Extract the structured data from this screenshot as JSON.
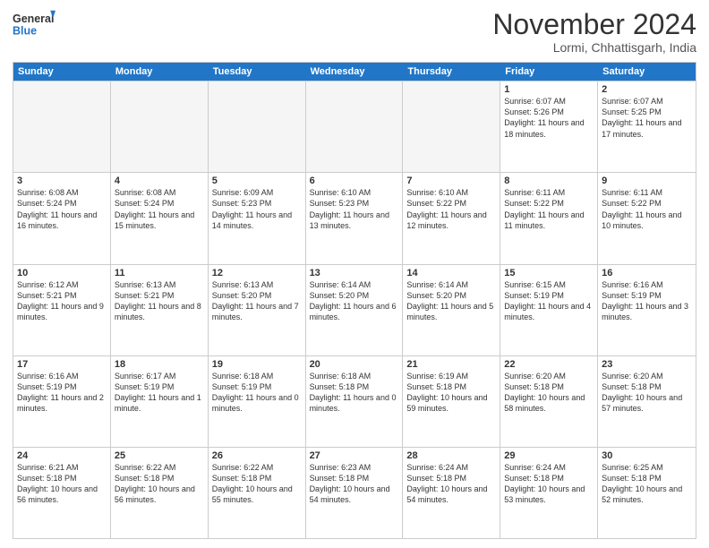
{
  "header": {
    "logo_general": "General",
    "logo_blue": "Blue",
    "title": "November 2024",
    "location": "Lormi, Chhattisgarh, India"
  },
  "calendar": {
    "days_of_week": [
      "Sunday",
      "Monday",
      "Tuesday",
      "Wednesday",
      "Thursday",
      "Friday",
      "Saturday"
    ],
    "rows": [
      [
        {
          "day": "",
          "empty": true
        },
        {
          "day": "",
          "empty": true
        },
        {
          "day": "",
          "empty": true
        },
        {
          "day": "",
          "empty": true
        },
        {
          "day": "",
          "empty": true
        },
        {
          "day": "1",
          "sunrise": "6:07 AM",
          "sunset": "5:26 PM",
          "daylight": "11 hours and 18 minutes."
        },
        {
          "day": "2",
          "sunrise": "6:07 AM",
          "sunset": "5:25 PM",
          "daylight": "11 hours and 17 minutes."
        }
      ],
      [
        {
          "day": "3",
          "sunrise": "6:08 AM",
          "sunset": "5:24 PM",
          "daylight": "11 hours and 16 minutes."
        },
        {
          "day": "4",
          "sunrise": "6:08 AM",
          "sunset": "5:24 PM",
          "daylight": "11 hours and 15 minutes."
        },
        {
          "day": "5",
          "sunrise": "6:09 AM",
          "sunset": "5:23 PM",
          "daylight": "11 hours and 14 minutes."
        },
        {
          "day": "6",
          "sunrise": "6:10 AM",
          "sunset": "5:23 PM",
          "daylight": "11 hours and 13 minutes."
        },
        {
          "day": "7",
          "sunrise": "6:10 AM",
          "sunset": "5:22 PM",
          "daylight": "11 hours and 12 minutes."
        },
        {
          "day": "8",
          "sunrise": "6:11 AM",
          "sunset": "5:22 PM",
          "daylight": "11 hours and 11 minutes."
        },
        {
          "day": "9",
          "sunrise": "6:11 AM",
          "sunset": "5:22 PM",
          "daylight": "11 hours and 10 minutes."
        }
      ],
      [
        {
          "day": "10",
          "sunrise": "6:12 AM",
          "sunset": "5:21 PM",
          "daylight": "11 hours and 9 minutes."
        },
        {
          "day": "11",
          "sunrise": "6:13 AM",
          "sunset": "5:21 PM",
          "daylight": "11 hours and 8 minutes."
        },
        {
          "day": "12",
          "sunrise": "6:13 AM",
          "sunset": "5:20 PM",
          "daylight": "11 hours and 7 minutes."
        },
        {
          "day": "13",
          "sunrise": "6:14 AM",
          "sunset": "5:20 PM",
          "daylight": "11 hours and 6 minutes."
        },
        {
          "day": "14",
          "sunrise": "6:14 AM",
          "sunset": "5:20 PM",
          "daylight": "11 hours and 5 minutes."
        },
        {
          "day": "15",
          "sunrise": "6:15 AM",
          "sunset": "5:19 PM",
          "daylight": "11 hours and 4 minutes."
        },
        {
          "day": "16",
          "sunrise": "6:16 AM",
          "sunset": "5:19 PM",
          "daylight": "11 hours and 3 minutes."
        }
      ],
      [
        {
          "day": "17",
          "sunrise": "6:16 AM",
          "sunset": "5:19 PM",
          "daylight": "11 hours and 2 minutes."
        },
        {
          "day": "18",
          "sunrise": "6:17 AM",
          "sunset": "5:19 PM",
          "daylight": "11 hours and 1 minute."
        },
        {
          "day": "19",
          "sunrise": "6:18 AM",
          "sunset": "5:19 PM",
          "daylight": "11 hours and 0 minutes."
        },
        {
          "day": "20",
          "sunrise": "6:18 AM",
          "sunset": "5:18 PM",
          "daylight": "11 hours and 0 minutes."
        },
        {
          "day": "21",
          "sunrise": "6:19 AM",
          "sunset": "5:18 PM",
          "daylight": "10 hours and 59 minutes."
        },
        {
          "day": "22",
          "sunrise": "6:20 AM",
          "sunset": "5:18 PM",
          "daylight": "10 hours and 58 minutes."
        },
        {
          "day": "23",
          "sunrise": "6:20 AM",
          "sunset": "5:18 PM",
          "daylight": "10 hours and 57 minutes."
        }
      ],
      [
        {
          "day": "24",
          "sunrise": "6:21 AM",
          "sunset": "5:18 PM",
          "daylight": "10 hours and 56 minutes."
        },
        {
          "day": "25",
          "sunrise": "6:22 AM",
          "sunset": "5:18 PM",
          "daylight": "10 hours and 56 minutes."
        },
        {
          "day": "26",
          "sunrise": "6:22 AM",
          "sunset": "5:18 PM",
          "daylight": "10 hours and 55 minutes."
        },
        {
          "day": "27",
          "sunrise": "6:23 AM",
          "sunset": "5:18 PM",
          "daylight": "10 hours and 54 minutes."
        },
        {
          "day": "28",
          "sunrise": "6:24 AM",
          "sunset": "5:18 PM",
          "daylight": "10 hours and 54 minutes."
        },
        {
          "day": "29",
          "sunrise": "6:24 AM",
          "sunset": "5:18 PM",
          "daylight": "10 hours and 53 minutes."
        },
        {
          "day": "30",
          "sunrise": "6:25 AM",
          "sunset": "5:18 PM",
          "daylight": "10 hours and 52 minutes."
        }
      ]
    ]
  },
  "labels": {
    "sunrise": "Sunrise:",
    "sunset": "Sunset:",
    "daylight": "Daylight:"
  }
}
